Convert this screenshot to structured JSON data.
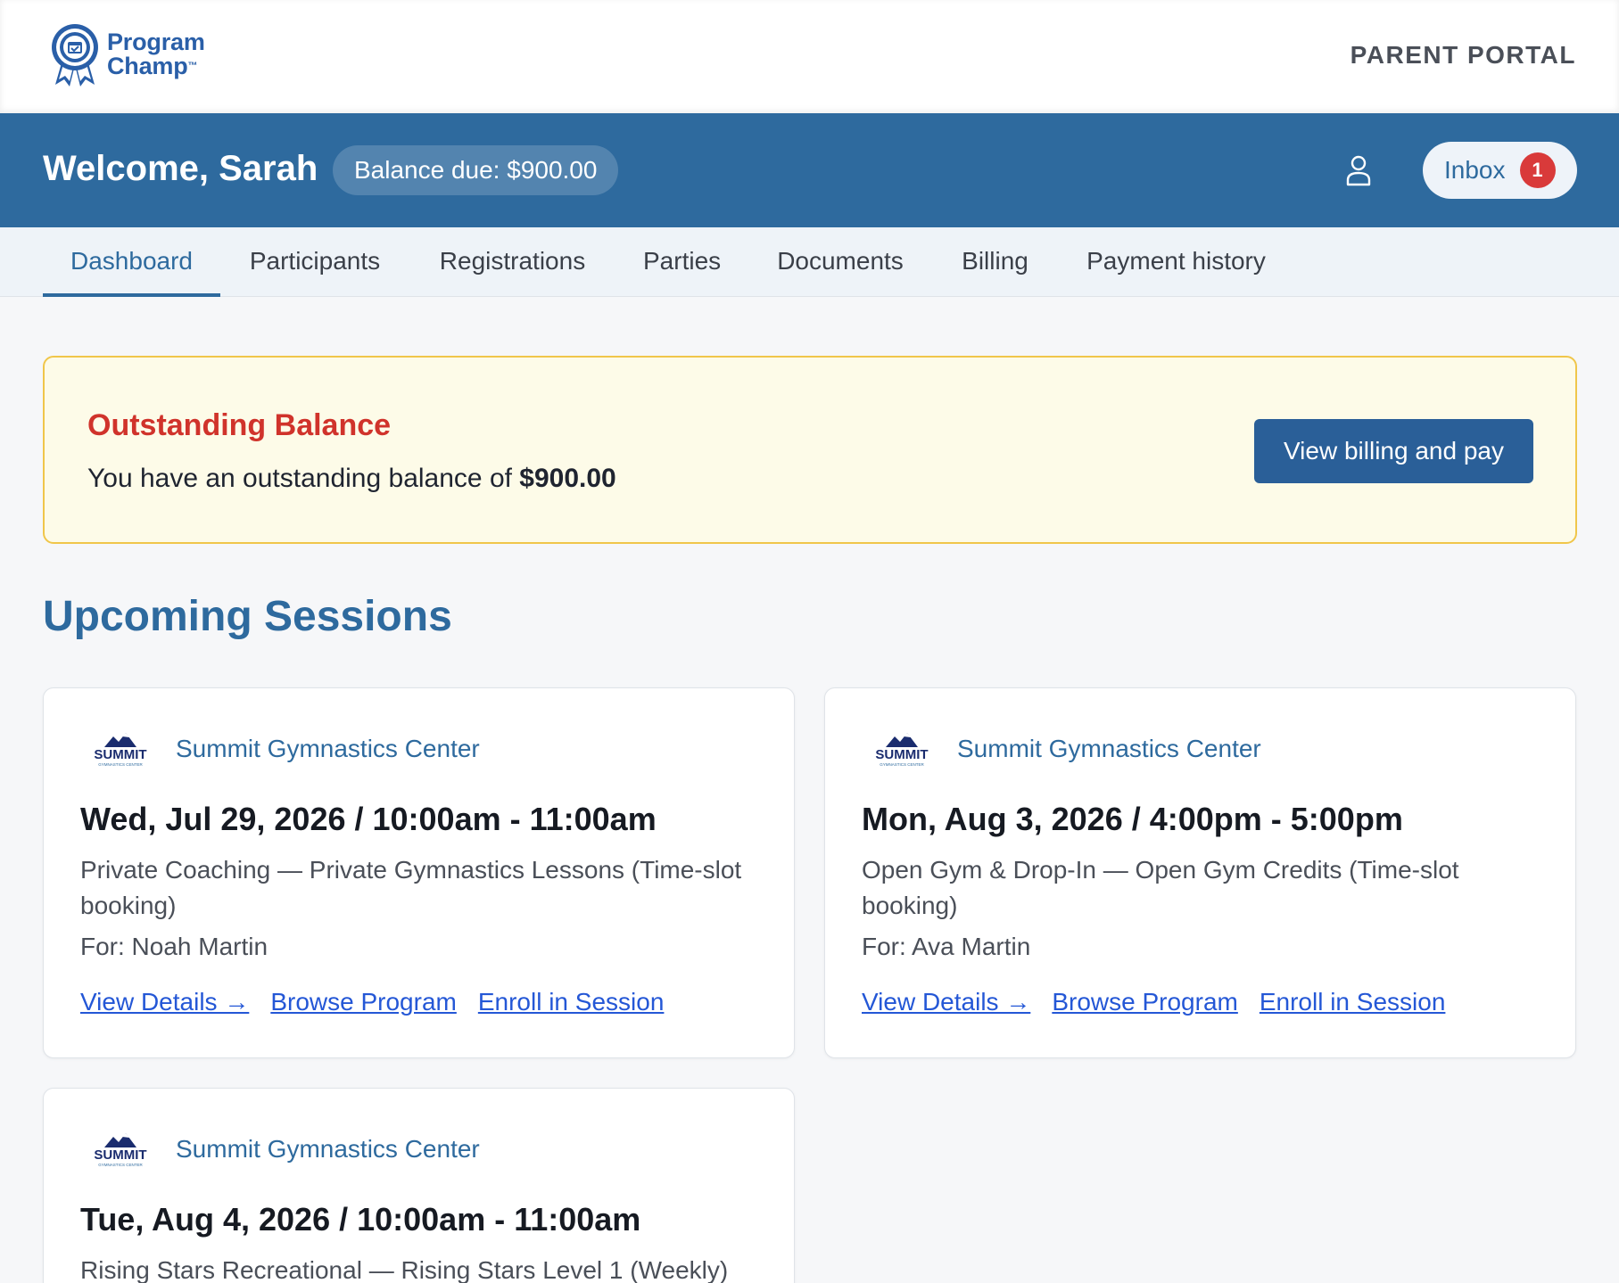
{
  "header": {
    "logo_text_line1": "Program",
    "logo_text_line2": "Champ",
    "logo_tm": "™",
    "portal_label": "PARENT PORTAL"
  },
  "welcome": {
    "title": "Welcome, Sarah",
    "balance_pill": "Balance due: $900.00",
    "inbox_label": "Inbox",
    "inbox_count": "1"
  },
  "tabs": [
    {
      "label": "Dashboard",
      "active": true
    },
    {
      "label": "Participants"
    },
    {
      "label": "Registrations"
    },
    {
      "label": "Parties"
    },
    {
      "label": "Documents"
    },
    {
      "label": "Billing"
    },
    {
      "label": "Payment history"
    }
  ],
  "alert": {
    "title": "Outstanding Balance",
    "text_prefix": "You have an outstanding balance of ",
    "amount": "$900.00",
    "button_label": "View billing and pay"
  },
  "section_title": "Upcoming Sessions",
  "sessions": [
    {
      "logo_text": "SUMMIT",
      "logo_subtext": "GYMNASTICS CENTER",
      "org": "Summit Gymnastics Center",
      "date": "Wed, Jul 29, 2026 / 10:00am - 11:00am",
      "description": "Private Coaching — Private Gymnastics Lessons (Time-slot booking)",
      "for": "For: Noah Martin",
      "link_details": "View Details →",
      "link_browse": "Browse Program",
      "link_enroll": "Enroll in Session"
    },
    {
      "logo_text": "SUMMIT",
      "logo_subtext": "GYMNASTICS CENTER",
      "org": "Summit Gymnastics Center",
      "date": "Mon, Aug 3, 2026 / 4:00pm - 5:00pm",
      "description": "Open Gym & Drop-In — Open Gym Credits (Time-slot booking)",
      "for": "For: Ava Martin",
      "link_details": "View Details →",
      "link_browse": "Browse Program",
      "link_enroll": "Enroll in Session"
    },
    {
      "logo_text": "SUMMIT",
      "logo_subtext": "GYMNASTICS CENTER",
      "org": "Summit Gymnastics Center",
      "date": "Tue, Aug 4, 2026 / 10:00am - 11:00am",
      "description": "Rising Stars Recreational — Rising Stars Level 1 (Weekly)"
    }
  ],
  "colors": {
    "brand_blue": "#2e6a9e",
    "alert_red": "#d0332b",
    "alert_bg": "#fdfbe8",
    "alert_border": "#f0c64a",
    "link_blue": "#2457d6",
    "badge_red": "#d93a3a"
  },
  "icons": {
    "logo": "award-ribbon-icon",
    "user": "user-icon"
  }
}
